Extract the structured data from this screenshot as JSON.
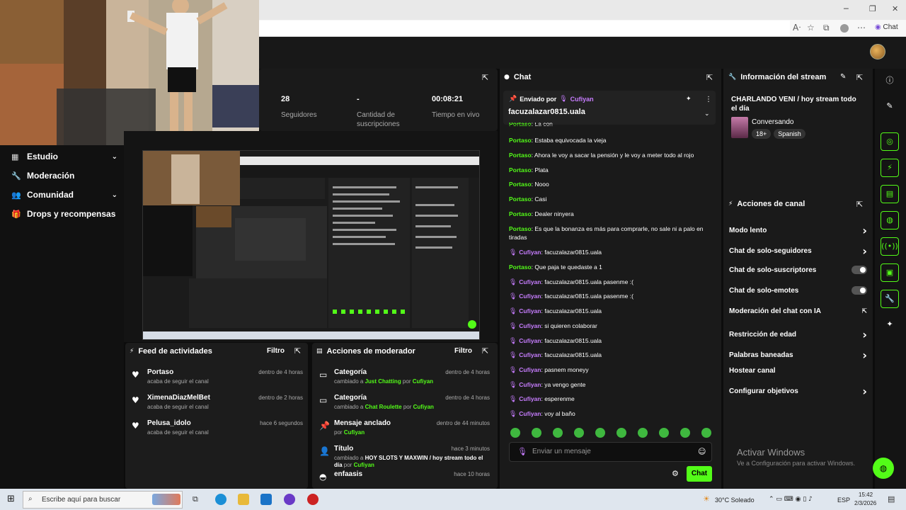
{
  "browser": {
    "chat_label": "Chat"
  },
  "nav": [
    {
      "label": "Estudio",
      "icon": "studio-icon",
      "chevron": true
    },
    {
      "label": "Moderación",
      "icon": "wrench-icon",
      "chevron": false
    },
    {
      "label": "Comunidad",
      "icon": "community-icon",
      "chevron": true
    },
    {
      "label": "Drops y recompensas",
      "icon": "gift-icon",
      "chevron": false
    }
  ],
  "stats": [
    {
      "value": "28",
      "label": "Seguidores"
    },
    {
      "value": "-",
      "label": "Cantidad de suscripciones"
    },
    {
      "value": "00:08:21",
      "label": "Tiempo en vivo"
    }
  ],
  "feed": {
    "title": "Feed de actividades",
    "filter": "Filtro",
    "items": [
      {
        "name": "Portaso",
        "sub": "acaba de seguir el canal",
        "time": "dentro de 4 horas"
      },
      {
        "name": "XimenaDiazMelBet",
        "sub": "acaba de seguir el canal",
        "time": "dentro de 2 horas"
      },
      {
        "name": "Pelusa_idolo",
        "sub": "acaba de seguir el canal",
        "time": "hace 6 segundos"
      }
    ]
  },
  "mod": {
    "title": "Acciones de moderador",
    "filter": "Filtro",
    "items": [
      {
        "title": "Categoría",
        "pre": "cambiado a ",
        "hl": "Just Chatting",
        "mid": " por ",
        "user": "Cufiyan",
        "time": "dentro de 4 horas"
      },
      {
        "title": "Categoría",
        "pre": "cambiado a ",
        "hl": "Chat Roulette",
        "mid": " por ",
        "user": "Cufiyan",
        "time": "dentro de 4 horas"
      },
      {
        "title": "Mensaje anclado",
        "pre": "por ",
        "hl": "",
        "mid": "",
        "user": "Cufiyan",
        "time": "dentro de 44 minutos"
      },
      {
        "title": "Título",
        "pre": "cambiado a ",
        "hl": "HOY SLOTS Y MAXWIN / hoy stream todo el día",
        "mid": " por ",
        "user": "Cufiyan",
        "time": "hace 3 minutos"
      },
      {
        "title": "enfaasis",
        "pre": "",
        "hl": "",
        "mid": "",
        "user": "",
        "time": "hace 10 horas"
      }
    ]
  },
  "chat": {
    "title": "Chat",
    "pinned_by_label": "Enviado por",
    "pinned_user": "Cufiyan",
    "pinned_text": "facuzalazar0815.uala",
    "messages": [
      {
        "user": "Portaso",
        "type": "p",
        "text": "La con"
      },
      {
        "user": "Portaso",
        "type": "p",
        "text": "Estaba equivocada la vieja"
      },
      {
        "user": "Portaso",
        "type": "p",
        "text": "Ahora le voy a sacar la pensión y le voy a meter todo al rojo"
      },
      {
        "user": "Portaso",
        "type": "p",
        "text": "Plata"
      },
      {
        "user": "Portaso",
        "type": "p",
        "text": "Nooo"
      },
      {
        "user": "Portaso",
        "type": "p",
        "text": "Casi"
      },
      {
        "user": "Portaso",
        "type": "p",
        "text": "Dealer ninyera"
      },
      {
        "user": "Portaso",
        "type": "p",
        "text": "Es que la bonanza es más para comprarle, no sale ni a palo en tiradas"
      },
      {
        "user": "Cufiyan",
        "type": "c",
        "text": "facuzalazar0815.uala"
      },
      {
        "user": "Portaso",
        "type": "p",
        "text": "Que paja te quedaste a 1"
      },
      {
        "user": "Cufiyan",
        "type": "c",
        "text": "facuzalazar0815.uala pasenme :("
      },
      {
        "user": "Cufiyan",
        "type": "c",
        "text": "facuzalazar0815.uala pasenme :("
      },
      {
        "user": "Cufiyan",
        "type": "c",
        "text": "facuzalazar0815.uala"
      },
      {
        "user": "Cufiyan",
        "type": "c",
        "text": "si quieren colaborar"
      },
      {
        "user": "Cufiyan",
        "type": "c",
        "text": "facuzalazar0815.uala"
      },
      {
        "user": "Cufiyan",
        "type": "c",
        "text": "facuzalazar0815.uala"
      },
      {
        "user": "Cufiyan",
        "type": "c",
        "text": "pasnem moneyy"
      },
      {
        "user": "Cufiyan",
        "type": "c",
        "text": "ya vengo gente"
      },
      {
        "user": "Cufiyan",
        "type": "c",
        "text": "esperenme"
      },
      {
        "user": "Cufiyan",
        "type": "c",
        "text": "voy al baño"
      }
    ],
    "placeholder": "Enviar un mensaje",
    "send_label": "Chat"
  },
  "info": {
    "title": "Información del stream",
    "stream_title": "CHARLANDO VENI / hoy stream todo el día",
    "category": "Conversando",
    "tags": [
      "18+",
      "Spanish"
    ]
  },
  "actions": {
    "title": "Acciones de canal",
    "items": [
      {
        "label": "Modo lento",
        "ctl": "chev"
      },
      {
        "label": "Chat de solo-seguidores",
        "ctl": "chev"
      },
      {
        "label": "Chat de solo-suscriptores",
        "ctl": "toggle"
      },
      {
        "label": "Chat de solo-emotes",
        "ctl": "toggle"
      },
      {
        "label": "Moderación del chat con IA",
        "ctl": "ext"
      },
      {
        "label": "Restricción de edad",
        "ctl": "chev"
      },
      {
        "label": "Palabras baneadas",
        "ctl": "chev"
      },
      {
        "label": "Hostear canal",
        "ctl": "none"
      },
      {
        "label": "Configurar objetivos",
        "ctl": "chev"
      }
    ]
  },
  "watermark": {
    "title": "Activar Windows",
    "sub": "Ve a Configuración para activar Windows."
  },
  "taskbar": {
    "search": "Escribe aquí para buscar",
    "weather": "30°C  Soleado",
    "lang": "ESP",
    "time": "15:42",
    "date": "2/3/2026"
  }
}
